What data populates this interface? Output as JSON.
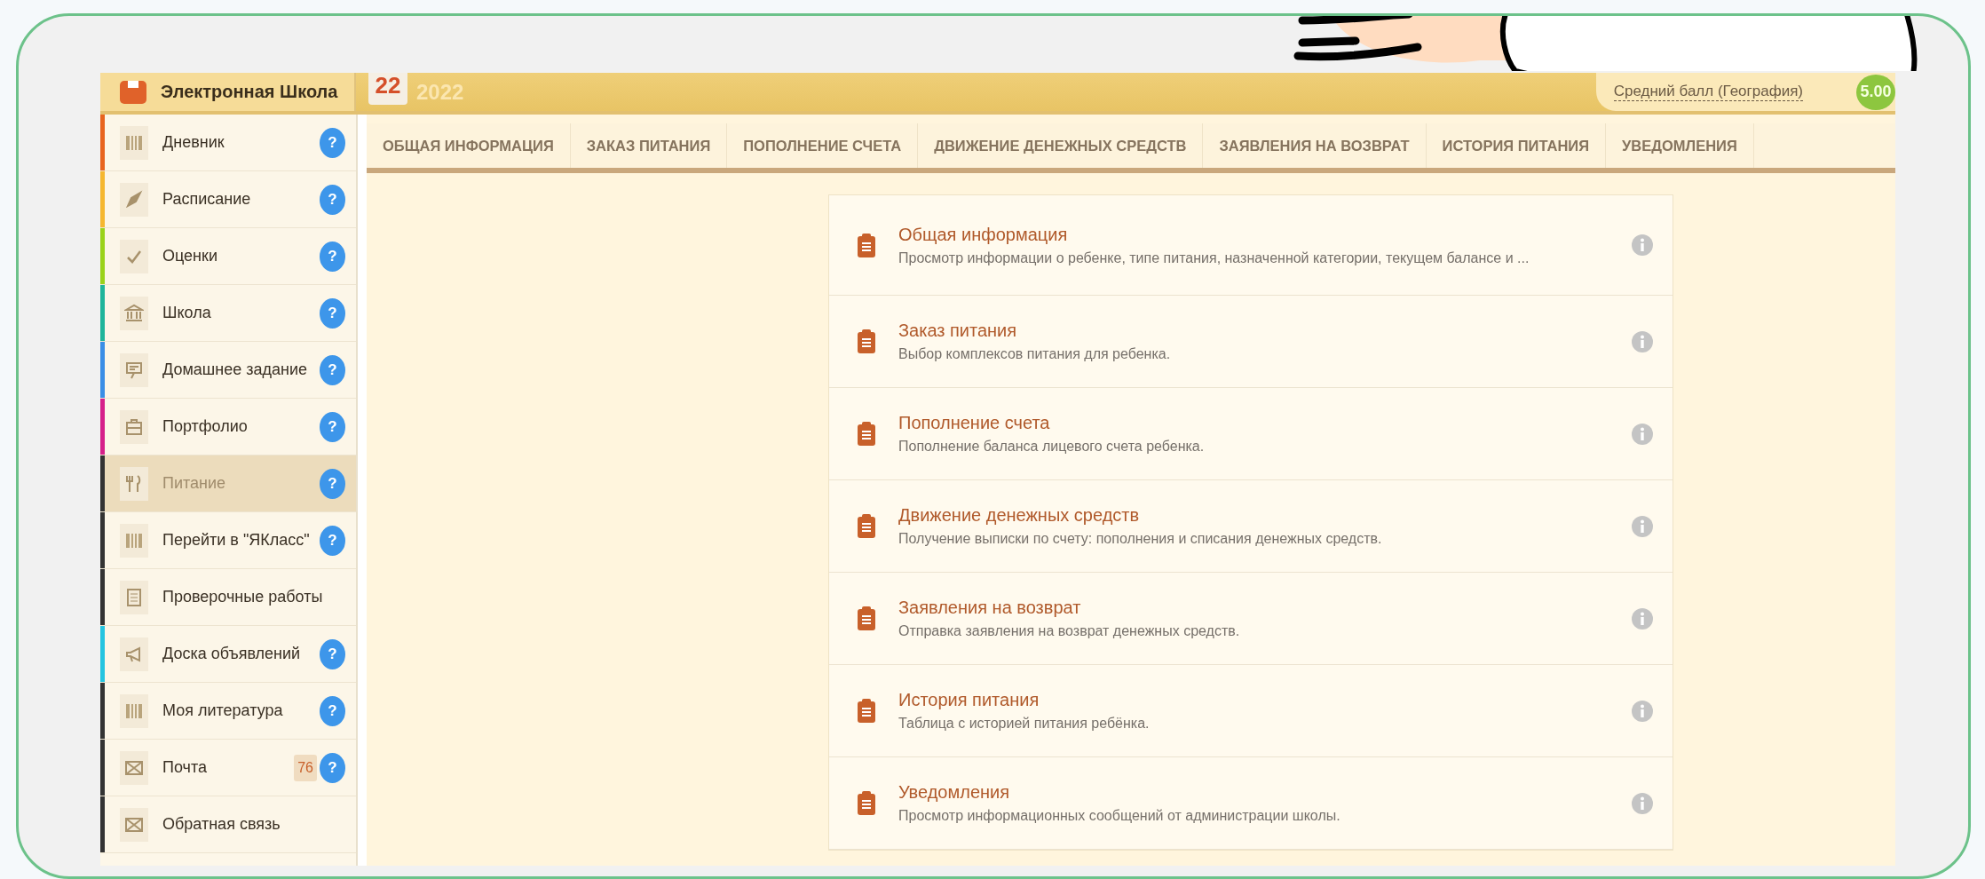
{
  "header": {
    "brand": "Электронная Школа",
    "calendar_day": "22",
    "year": "2022",
    "average_label": "Средний балл (География)",
    "average_value": "5.00"
  },
  "sidebar": {
    "items": [
      {
        "label": "Дневник",
        "color": "#e8641e",
        "help": "?",
        "selected": false
      },
      {
        "label": "Расписание",
        "color": "#f5b730",
        "help": "?",
        "selected": false
      },
      {
        "label": "Оценки",
        "color": "#9ad21a",
        "help": "?",
        "selected": false
      },
      {
        "label": "Школа",
        "color": "#1fb59a",
        "help": "?",
        "selected": false
      },
      {
        "label": "Домашнее задание",
        "color": "#3a8ee6",
        "help": "?",
        "selected": false
      },
      {
        "label": "Портфолио",
        "color": "#d6208a",
        "help": "?",
        "selected": false
      },
      {
        "label": "Питание",
        "color": "#333333",
        "help": "?",
        "selected": true
      },
      {
        "label": "Перейти в \"ЯКласс\"",
        "color": "#333333",
        "help": "?",
        "selected": false
      },
      {
        "label": "Проверочные работы",
        "color": "#333333",
        "selected": false
      },
      {
        "label": "Доска объявлений",
        "color": "#25c4e0",
        "help": "?",
        "selected": false
      },
      {
        "label": "Моя литература",
        "color": "#333333",
        "help": "?",
        "selected": false
      },
      {
        "label": "Почта",
        "color": "#333333",
        "badge": "76",
        "help": "?",
        "selected": false
      },
      {
        "label": "Обратная связь",
        "color": "#333333",
        "selected": false
      }
    ]
  },
  "tabs": [
    {
      "label": "ОБЩАЯ ИНФОРМАЦИЯ",
      "selected": false
    },
    {
      "label": "ЗАКАЗ ПИТАНИЯ",
      "selected": false
    },
    {
      "label": "ПОПОЛНЕНИЕ СЧЕТА",
      "selected": false
    },
    {
      "label": "ДВИЖЕНИЕ ДЕНЕЖНЫХ СРЕДСТВ",
      "selected": false
    },
    {
      "label": "ЗАЯВЛЕНИЯ НА ВОЗВРАТ",
      "selected": false
    },
    {
      "label": "ИСТОРИЯ ПИТАНИЯ",
      "selected": false
    },
    {
      "label": "УВЕДОМЛЕНИЯ",
      "selected": false
    }
  ],
  "sections": [
    {
      "title": "Общая информация",
      "description": "Просмотр информации о ребенке, типе питания, назначенной категории, текущем балансе и ..."
    },
    {
      "title": "Заказ питания",
      "description": "Выбор комплексов питания для ребенка."
    },
    {
      "title": "Пополнение счета",
      "description": "Пополнение баланса лицевого счета ребенка."
    },
    {
      "title": "Движение денежных средств",
      "description": "Получение выписки по счету: пополнения и списания денежных средств."
    },
    {
      "title": "Заявления на возврат",
      "description": "Отправка заявления на возврат денежных средств."
    },
    {
      "title": "История питания",
      "description": "Таблица с историей питания ребёнка."
    },
    {
      "title": "Уведомления",
      "description": "Просмотр информационных сообщений от администрации школы."
    }
  ]
}
